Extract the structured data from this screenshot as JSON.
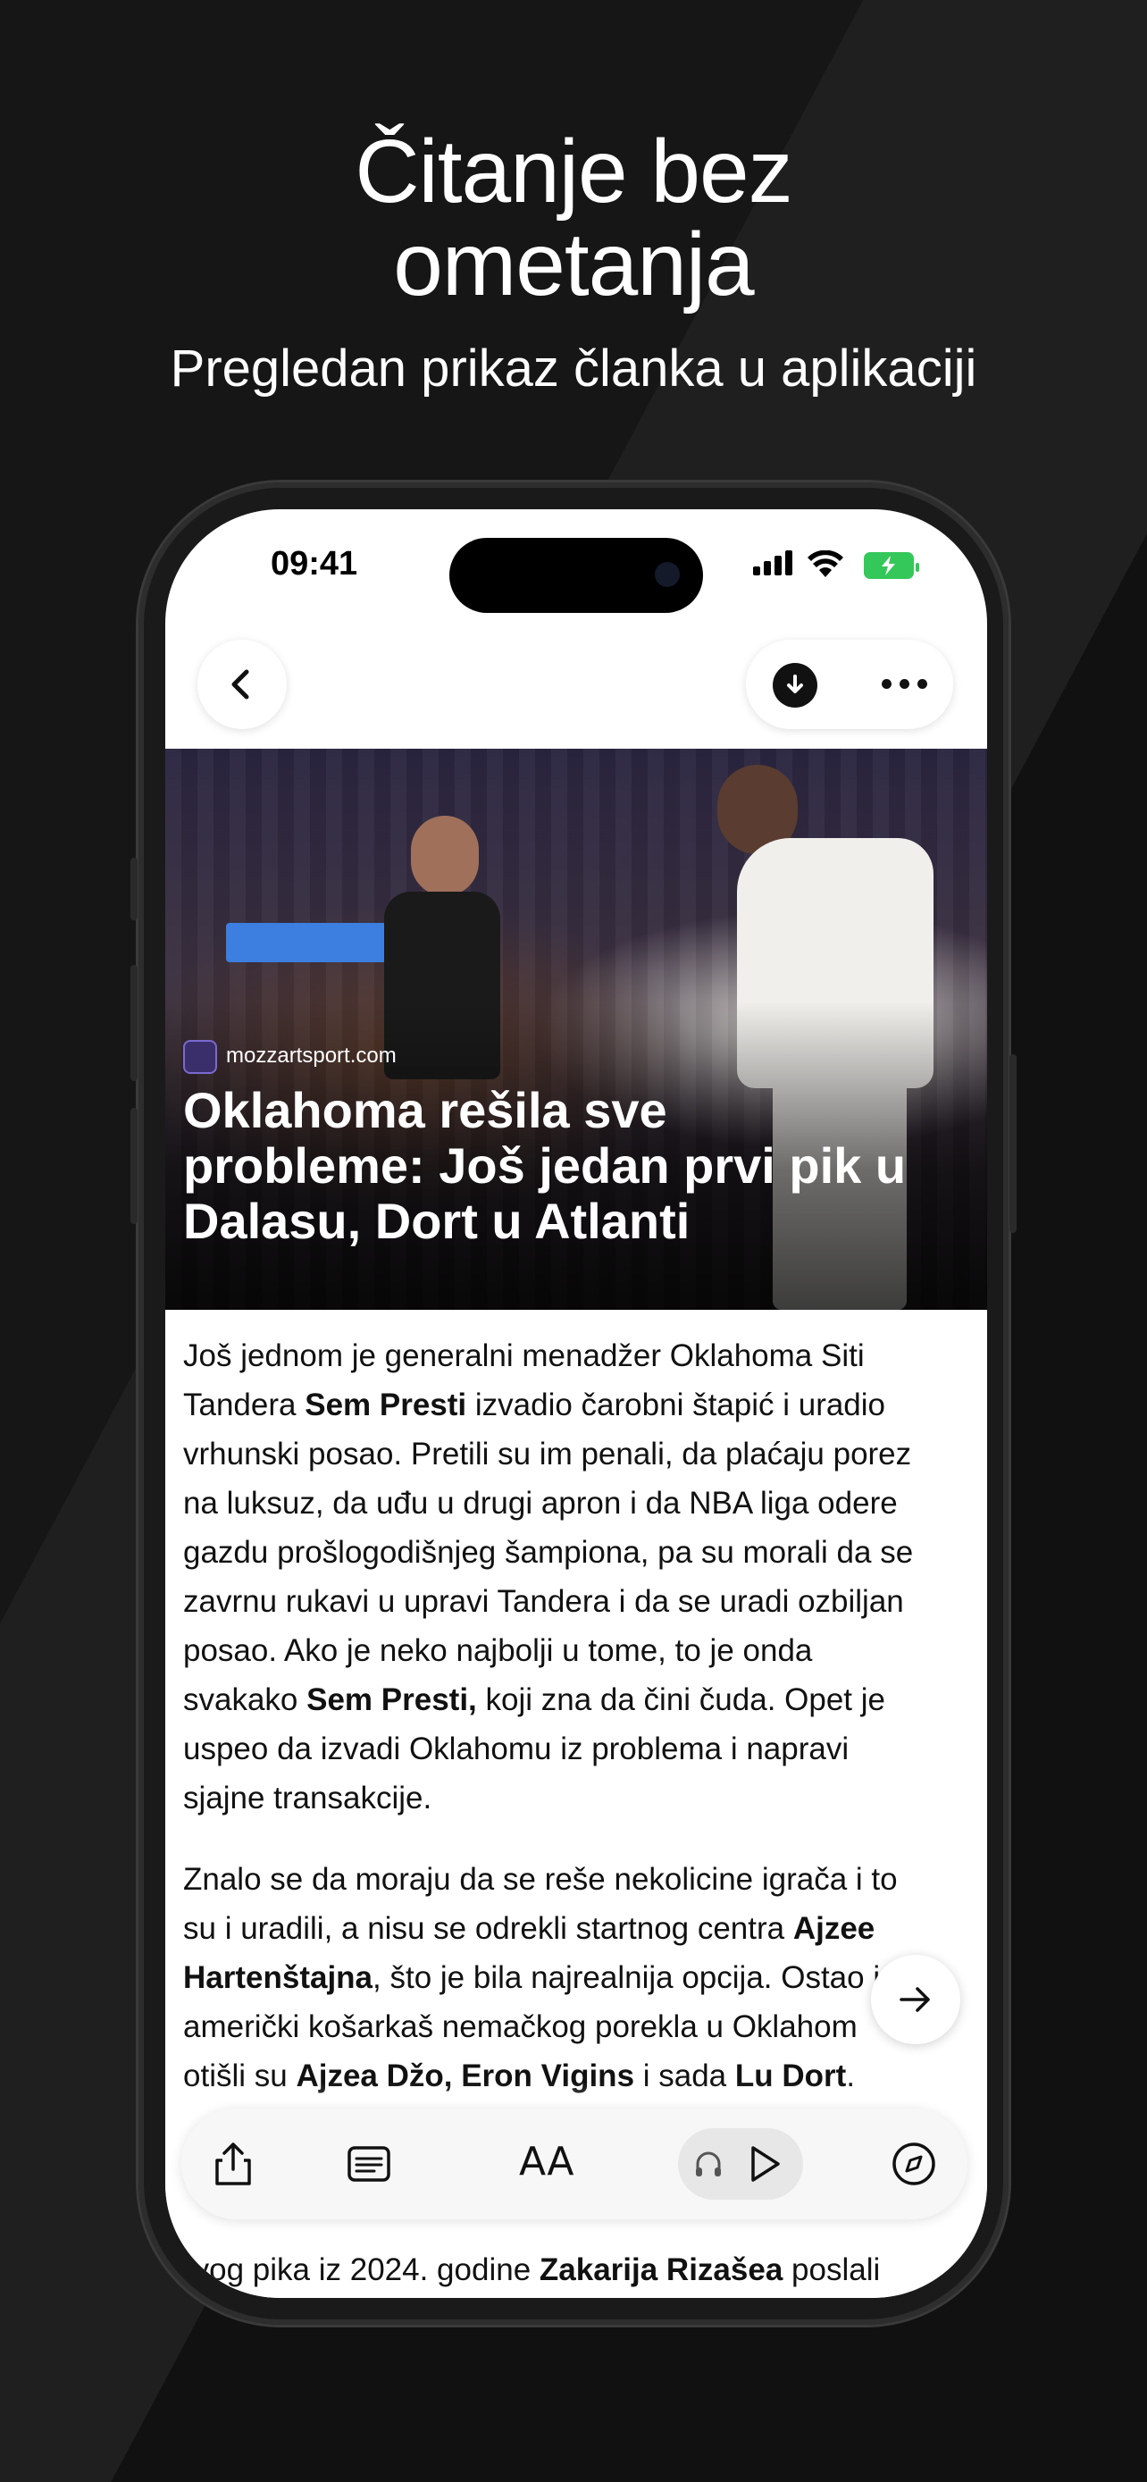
{
  "headline": {
    "title_lines": [
      "Čitanje bez",
      "ometanja"
    ],
    "subtitle": "Pregledan prikaz članka u aplikaciji"
  },
  "status_bar": {
    "time": "09:41",
    "icons": [
      "cellular-signal-icon",
      "wifi-icon",
      "battery-charging-icon"
    ]
  },
  "nav": {
    "back_icon": "chevron-left-icon",
    "download_icon": "download-icon",
    "more_icon": "more-horizontal-icon"
  },
  "article": {
    "source": "mozzartsport.com",
    "title_lines": [
      "Oklahoma rešila sve",
      "probleme: Još jedan prvi pik u",
      "Dalasu, Dort u Atlanti"
    ],
    "paragraph1": {
      "l1": "Još jednom je generalni menadžer Oklahoma Siti",
      "l2a": "Tandera ",
      "l2b": "Sem Presti",
      "l2c": " izvadio čarobni štapić i uradio",
      "l3": "vrhunski posao. Pretili su im penali, da plaćaju porez",
      "l4": "na luksuz, da uđu u drugi apron i da NBA liga odere",
      "l5": "gazdu prošlogodišnjeg šampiona, pa su morali da se",
      "l6": "zavrnu rukavi u upravi Tandera i da se uradi ozbiljan",
      "l7": "posao. Ako je neko najbolji u tome, to je onda",
      "l8a": "svakako ",
      "l8b": "Sem Presti,",
      "l8c": " koji zna da čini čuda. Opet je",
      "l9": "uspeo da izvadi Oklahomu iz problema i napravi",
      "l10": "sjajne transakcije."
    },
    "paragraph2": {
      "l1": "Znalo se da moraju da se reše nekolicine igrača i to",
      "l2a": "su i uradili, a nisu se odrekli startnog centra ",
      "l2b": "Ajzee",
      "l3a": "Hartenštajna",
      "l3b": ", što je bila najrealnija opcija. Ostao je",
      "l4": "američki košarkaš nemačkog porekla u Oklahom",
      "l5a": "otišli su ",
      "l5b": "Ajzea Džo, Eron Vigins",
      "l5c": " i sada ",
      "l5d": "Lu Dort",
      "l5e": "."
    },
    "last_line_a": "rvog pika iz 2024. godine ",
    "last_line_b": "Zakarija Rizašea",
    "last_line_c": " poslali"
  },
  "toolbar": {
    "share_icon": "share-icon",
    "reader_icon": "reader-view-icon",
    "text_size_label": "AA",
    "headphones_icon": "headphones-icon",
    "play_icon": "play-icon",
    "compass_icon": "compass-icon",
    "next_icon": "arrow-right-icon"
  }
}
